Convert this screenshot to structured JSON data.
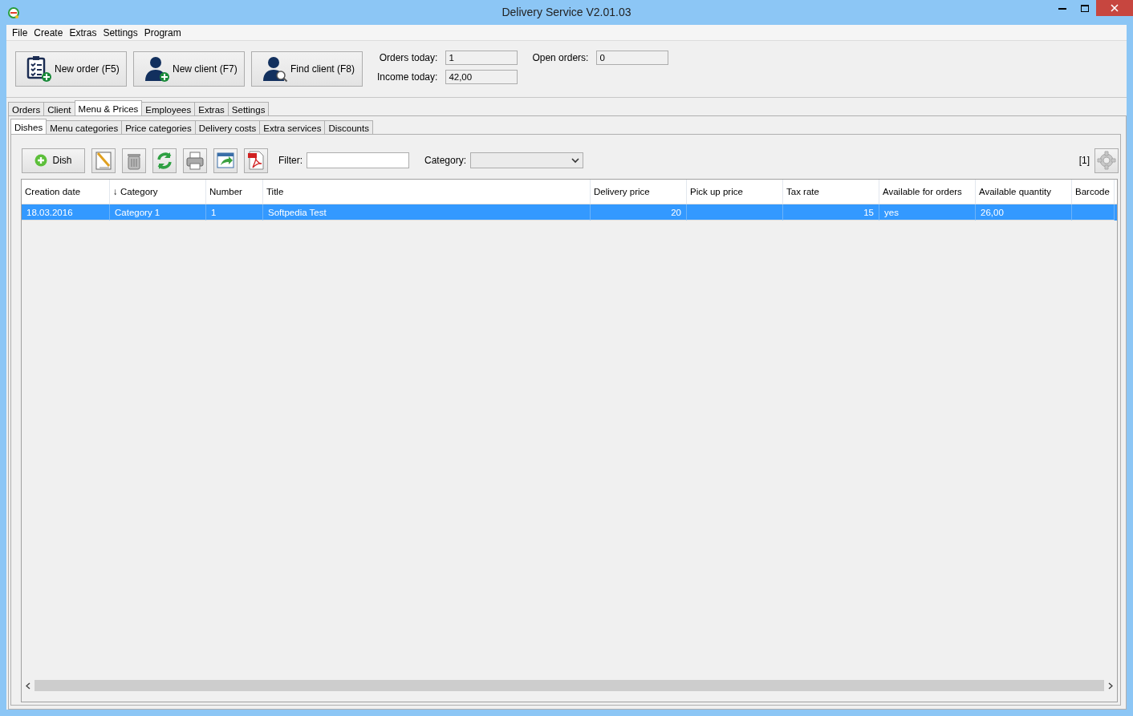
{
  "window": {
    "title": "Delivery Service V2.01.03"
  },
  "menu": [
    "File",
    "Create",
    "Extras",
    "Settings",
    "Program"
  ],
  "actions": [
    {
      "label": "New order (F5)",
      "kind": "order"
    },
    {
      "label": "New client (F7)",
      "kind": "add-client"
    },
    {
      "label": "Find client (F8)",
      "kind": "find-client"
    }
  ],
  "stats": [
    {
      "label": "Orders today:",
      "value": "1"
    },
    {
      "label": "Open orders:",
      "value": "0"
    },
    {
      "label": "Income today:",
      "value": "42,00"
    }
  ],
  "tabs": [
    {
      "label": "Orders",
      "selected": false
    },
    {
      "label": "Client",
      "selected": false
    },
    {
      "label": "Menu & Prices",
      "selected": true
    },
    {
      "label": "Employees",
      "selected": false
    },
    {
      "label": "Extras",
      "selected": false
    },
    {
      "label": "Settings",
      "selected": false
    }
  ],
  "subtabs": [
    {
      "label": "Dishes",
      "selected": true
    },
    {
      "label": "Menu categories",
      "selected": false
    },
    {
      "label": "Price categories",
      "selected": false
    },
    {
      "label": "Delivery costs",
      "selected": false
    },
    {
      "label": "Extra services",
      "selected": false
    },
    {
      "label": "Discounts",
      "selected": false
    }
  ],
  "toolbar": {
    "add_label": "Dish",
    "tools": [
      {
        "kind": "edit"
      },
      {
        "kind": "delete"
      },
      {
        "kind": "refresh"
      },
      {
        "kind": "print"
      },
      {
        "kind": "export"
      },
      {
        "kind": "pdf"
      }
    ],
    "filter_label": "Filter:",
    "category_label": "Category:",
    "count": "[1]"
  },
  "table": {
    "columns": [
      {
        "label": "Creation date",
        "kind": "text"
      },
      {
        "label": "↓ Category",
        "kind": "text"
      },
      {
        "label": "Number",
        "kind": "text"
      },
      {
        "label": "Title",
        "kind": "text"
      },
      {
        "label": "Delivery price",
        "kind": "number"
      },
      {
        "label": "Pick up price",
        "kind": "number"
      },
      {
        "label": "Tax rate",
        "kind": "number"
      },
      {
        "label": "Available for orders",
        "kind": "text"
      },
      {
        "label": "Available quantity",
        "kind": "text"
      },
      {
        "label": "Barcode",
        "kind": "text"
      }
    ],
    "rows": [
      {
        "cells": [
          "18.03.2016",
          "Category 1",
          "1",
          "Softpedia Test",
          "20",
          null,
          "15",
          "yes",
          "26,00",
          null
        ],
        "selected": true
      }
    ]
  }
}
